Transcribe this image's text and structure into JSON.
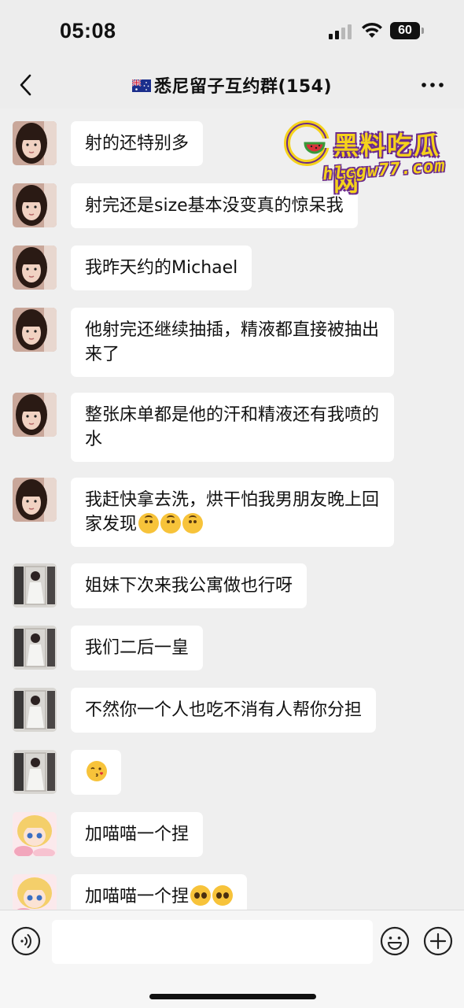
{
  "status": {
    "time": "05:08",
    "battery": "60"
  },
  "header": {
    "title": "悉尼留子互约群(154)"
  },
  "watermark": {
    "text": "黑料吃瓜网",
    "url": "hlcgw77.com"
  },
  "messages": [
    {
      "avatar": "girl-selfie-avatar",
      "text": "射的还特别多",
      "emojis": []
    },
    {
      "avatar": "girl-selfie-avatar",
      "text": "射完还是size基本没变真的惊呆我",
      "emojis": []
    },
    {
      "avatar": "girl-selfie-avatar",
      "text": "我昨天约的Michael",
      "emojis": []
    },
    {
      "avatar": "girl-selfie-avatar",
      "text": "他射完还继续抽插，精液都直接被抽出来了",
      "emojis": []
    },
    {
      "avatar": "girl-selfie-avatar",
      "text": "整张床单都是他的汗和精液还有我喷的水",
      "emojis": []
    },
    {
      "avatar": "girl-selfie-avatar",
      "text": "我赶快拿去洗，烘干怕我男朋友晚上回家发现",
      "emojis": [
        "upside-down-face",
        "upside-down-face",
        "upside-down-face"
      ]
    },
    {
      "avatar": "mirror-selfie-avatar",
      "text": "姐妹下次来我公寓做也行呀",
      "emojis": []
    },
    {
      "avatar": "mirror-selfie-avatar",
      "text": "我们二后一皇",
      "emojis": []
    },
    {
      "avatar": "mirror-selfie-avatar",
      "text": "不然你一个人也吃不消有人帮你分担",
      "emojis": []
    },
    {
      "avatar": "mirror-selfie-avatar",
      "text": "",
      "emojis": [
        "kissing-heart-face"
      ]
    },
    {
      "avatar": "anime-girl-avatar",
      "text": "加喵喵一个捏",
      "emojis": []
    },
    {
      "avatar": "anime-girl-avatar",
      "text": "加喵喵一个捏",
      "emojis": [
        "pleading-face",
        "pleading-face"
      ]
    }
  ],
  "input": {
    "placeholder": ""
  },
  "colors": {
    "background": "#efefef",
    "bubble": "#ffffff",
    "watermark": "#f5d21b"
  }
}
